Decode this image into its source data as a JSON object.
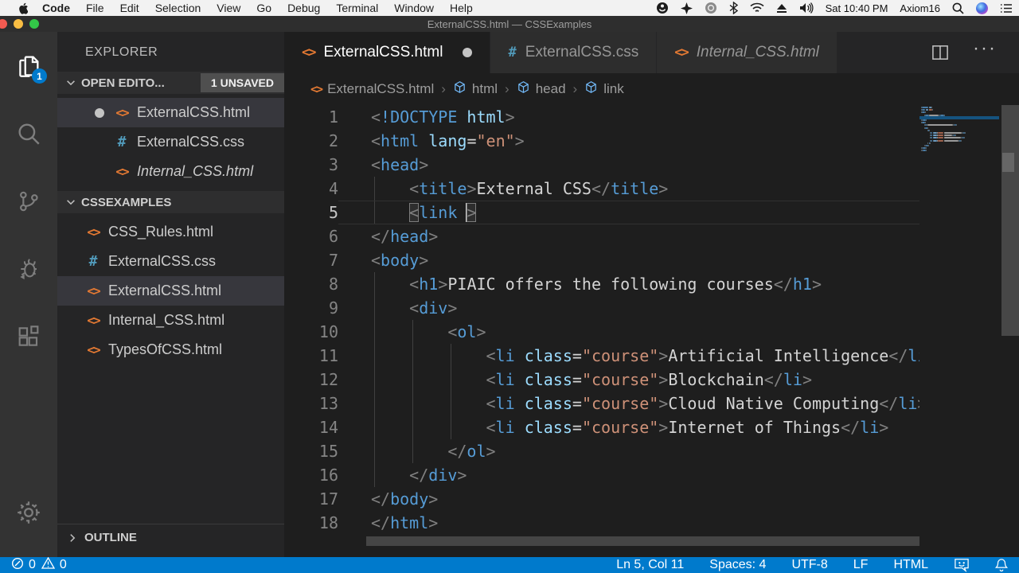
{
  "menu_bar": {
    "items": [
      "Code",
      "File",
      "Edit",
      "Selection",
      "View",
      "Go",
      "Debug",
      "Terminal",
      "Window",
      "Help"
    ],
    "status_icons": [
      "obs",
      "avast",
      "adobe-cc",
      "bluetooth",
      "wifi",
      "eject",
      "volume"
    ],
    "time": "Sat 10:40 PM",
    "user": "Axiom16",
    "right_icons": [
      "spotlight",
      "siri",
      "notification-list"
    ]
  },
  "title_bar": {
    "title": "ExternalCSS.html — CSSExamples"
  },
  "activity_bar": {
    "items": [
      {
        "name": "explorer",
        "icon": "files",
        "active": true,
        "badge": "1"
      },
      {
        "name": "search",
        "icon": "search",
        "active": false
      },
      {
        "name": "source-control",
        "icon": "source-control",
        "active": false
      },
      {
        "name": "debug",
        "icon": "debug",
        "active": false
      },
      {
        "name": "extensions",
        "icon": "extensions",
        "active": false
      }
    ],
    "bottom_items": [
      {
        "name": "settings",
        "icon": "gear"
      }
    ]
  },
  "sidebar": {
    "title": "EXPLORER",
    "open_editors": {
      "label": "OPEN EDITO...",
      "badge": "1 UNSAVED",
      "items": [
        {
          "label": "ExternalCSS.html",
          "icon": "code-tag",
          "modified": true,
          "selected": true,
          "italic": false
        },
        {
          "label": "ExternalCSS.css",
          "icon": "hash",
          "modified": false,
          "selected": false,
          "italic": false
        },
        {
          "label": "Internal_CSS.html",
          "icon": "code-tag",
          "modified": false,
          "selected": false,
          "italic": true
        }
      ]
    },
    "folder": {
      "label": "CSSEXAMPLES",
      "items": [
        {
          "label": "CSS_Rules.html",
          "icon": "code-tag",
          "selected": false
        },
        {
          "label": "ExternalCSS.css",
          "icon": "hash",
          "selected": false
        },
        {
          "label": "ExternalCSS.html",
          "icon": "code-tag",
          "selected": true
        },
        {
          "label": "Internal_CSS.html",
          "icon": "code-tag",
          "selected": false
        },
        {
          "label": "TypesOfCSS.html",
          "icon": "code-tag",
          "selected": false
        }
      ]
    },
    "outline_label": "OUTLINE"
  },
  "editor": {
    "tabs": [
      {
        "label": "ExternalCSS.html",
        "icon": "code-tag",
        "active": true,
        "modified": true,
        "italic": false
      },
      {
        "label": "ExternalCSS.css",
        "icon": "hash",
        "active": false,
        "modified": false,
        "italic": false
      },
      {
        "label": "Internal_CSS.html",
        "icon": "code-tag",
        "active": false,
        "modified": false,
        "italic": true
      }
    ],
    "breadcrumbs": [
      {
        "label": "ExternalCSS.html",
        "icon": "code-tag"
      },
      {
        "label": "html",
        "icon": "cube"
      },
      {
        "label": "head",
        "icon": "cube"
      },
      {
        "label": "link",
        "icon": "cube"
      }
    ],
    "lines": [
      {
        "n": 1,
        "ind": 0,
        "tok": [
          [
            "<",
            "p"
          ],
          [
            "!DOCTYPE",
            "tag"
          ],
          [
            " ",
            "t"
          ],
          [
            "html",
            "attr"
          ],
          [
            ">",
            "p"
          ]
        ]
      },
      {
        "n": 2,
        "ind": 0,
        "tok": [
          [
            "<",
            "p"
          ],
          [
            "html",
            "tag"
          ],
          [
            " ",
            "t"
          ],
          [
            "lang",
            "attr"
          ],
          [
            "=",
            "t"
          ],
          [
            "\"en\"",
            "str"
          ],
          [
            ">",
            "p"
          ]
        ]
      },
      {
        "n": 3,
        "ind": 0,
        "tok": [
          [
            "<",
            "p"
          ],
          [
            "head",
            "tag"
          ],
          [
            ">",
            "p"
          ]
        ]
      },
      {
        "n": 4,
        "ind": 4,
        "tok": [
          [
            "    ",
            "t"
          ],
          [
            "<",
            "p"
          ],
          [
            "title",
            "tag"
          ],
          [
            ">",
            "p"
          ],
          [
            "External CSS",
            "t"
          ],
          [
            "</",
            "p"
          ],
          [
            "title",
            "tag"
          ],
          [
            ">",
            "p"
          ]
        ]
      },
      {
        "n": 5,
        "ind": 4,
        "current": true,
        "tok": [
          [
            "    ",
            "t"
          ],
          [
            "<",
            "pb"
          ],
          [
            "link",
            "tag"
          ],
          [
            " ",
            "t"
          ],
          [
            "",
            "cur"
          ],
          [
            ">",
            "pb"
          ]
        ]
      },
      {
        "n": 6,
        "ind": 0,
        "tok": [
          [
            "</",
            "p"
          ],
          [
            "head",
            "tag"
          ],
          [
            ">",
            "p"
          ]
        ]
      },
      {
        "n": 7,
        "ind": 0,
        "tok": [
          [
            "<",
            "p"
          ],
          [
            "body",
            "tag"
          ],
          [
            ">",
            "p"
          ]
        ]
      },
      {
        "n": 8,
        "ind": 4,
        "tok": [
          [
            "    ",
            "t"
          ],
          [
            "<",
            "p"
          ],
          [
            "h1",
            "tag"
          ],
          [
            ">",
            "p"
          ],
          [
            "PIAIC offers the following courses",
            "t"
          ],
          [
            "</",
            "p"
          ],
          [
            "h1",
            "tag"
          ],
          [
            ">",
            "p"
          ]
        ]
      },
      {
        "n": 9,
        "ind": 4,
        "tok": [
          [
            "    ",
            "t"
          ],
          [
            "<",
            "p"
          ],
          [
            "div",
            "tag"
          ],
          [
            ">",
            "p"
          ]
        ]
      },
      {
        "n": 10,
        "ind": 8,
        "tok": [
          [
            "        ",
            "t"
          ],
          [
            "<",
            "p"
          ],
          [
            "ol",
            "tag"
          ],
          [
            ">",
            "p"
          ]
        ]
      },
      {
        "n": 11,
        "ind": 12,
        "tok": [
          [
            "            ",
            "t"
          ],
          [
            "<",
            "p"
          ],
          [
            "li",
            "tag"
          ],
          [
            " ",
            "t"
          ],
          [
            "class",
            "attr"
          ],
          [
            "=",
            "t"
          ],
          [
            "\"course\"",
            "str"
          ],
          [
            ">",
            "p"
          ],
          [
            "Artificial Intelligence",
            "t"
          ],
          [
            "</",
            "p"
          ],
          [
            "li",
            "tag"
          ],
          [
            ">",
            "p"
          ]
        ]
      },
      {
        "n": 12,
        "ind": 12,
        "tok": [
          [
            "            ",
            "t"
          ],
          [
            "<",
            "p"
          ],
          [
            "li",
            "tag"
          ],
          [
            " ",
            "t"
          ],
          [
            "class",
            "attr"
          ],
          [
            "=",
            "t"
          ],
          [
            "\"course\"",
            "str"
          ],
          [
            ">",
            "p"
          ],
          [
            "Blockchain",
            "t"
          ],
          [
            "</",
            "p"
          ],
          [
            "li",
            "tag"
          ],
          [
            ">",
            "p"
          ]
        ]
      },
      {
        "n": 13,
        "ind": 12,
        "tok": [
          [
            "            ",
            "t"
          ],
          [
            "<",
            "p"
          ],
          [
            "li",
            "tag"
          ],
          [
            " ",
            "t"
          ],
          [
            "class",
            "attr"
          ],
          [
            "=",
            "t"
          ],
          [
            "\"course\"",
            "str"
          ],
          [
            ">",
            "p"
          ],
          [
            "Cloud Native Computing",
            "t"
          ],
          [
            "</",
            "p"
          ],
          [
            "li",
            "tag"
          ],
          [
            ">",
            "p"
          ]
        ]
      },
      {
        "n": 14,
        "ind": 12,
        "tok": [
          [
            "            ",
            "t"
          ],
          [
            "<",
            "p"
          ],
          [
            "li",
            "tag"
          ],
          [
            " ",
            "t"
          ],
          [
            "class",
            "attr"
          ],
          [
            "=",
            "t"
          ],
          [
            "\"course\"",
            "str"
          ],
          [
            ">",
            "p"
          ],
          [
            "Internet of Things",
            "t"
          ],
          [
            "</",
            "p"
          ],
          [
            "li",
            "tag"
          ],
          [
            ">",
            "p"
          ]
        ]
      },
      {
        "n": 15,
        "ind": 8,
        "tok": [
          [
            "        ",
            "t"
          ],
          [
            "</",
            "p"
          ],
          [
            "ol",
            "tag"
          ],
          [
            ">",
            "p"
          ]
        ]
      },
      {
        "n": 16,
        "ind": 4,
        "tok": [
          [
            "    ",
            "t"
          ],
          [
            "</",
            "p"
          ],
          [
            "div",
            "tag"
          ],
          [
            ">",
            "p"
          ]
        ]
      },
      {
        "n": 17,
        "ind": 0,
        "tok": [
          [
            "</",
            "p"
          ],
          [
            "body",
            "tag"
          ],
          [
            ">",
            "p"
          ]
        ]
      },
      {
        "n": 18,
        "ind": 0,
        "tok": [
          [
            "</",
            "p"
          ],
          [
            "html",
            "tag"
          ],
          [
            ">",
            "p"
          ]
        ]
      }
    ]
  },
  "status_bar": {
    "left": [
      {
        "icon": "error-circle",
        "label": "0"
      },
      {
        "icon": "warning-triangle",
        "label": "0"
      }
    ],
    "right": [
      "Ln 5, Col 11",
      "Spaces: 4",
      "UTF-8",
      "LF",
      "HTML"
    ],
    "right_icons": [
      "feedback",
      "bell"
    ]
  },
  "colors": {
    "accent": "#007acc",
    "html_icon": "#e37933",
    "css_icon": "#519aba",
    "cube_icon": "#75beff",
    "tag": "#569cd6",
    "attribute": "#9cdcfe",
    "string": "#ce9178",
    "punctuation": "#808080",
    "text": "#d4d4d4"
  }
}
